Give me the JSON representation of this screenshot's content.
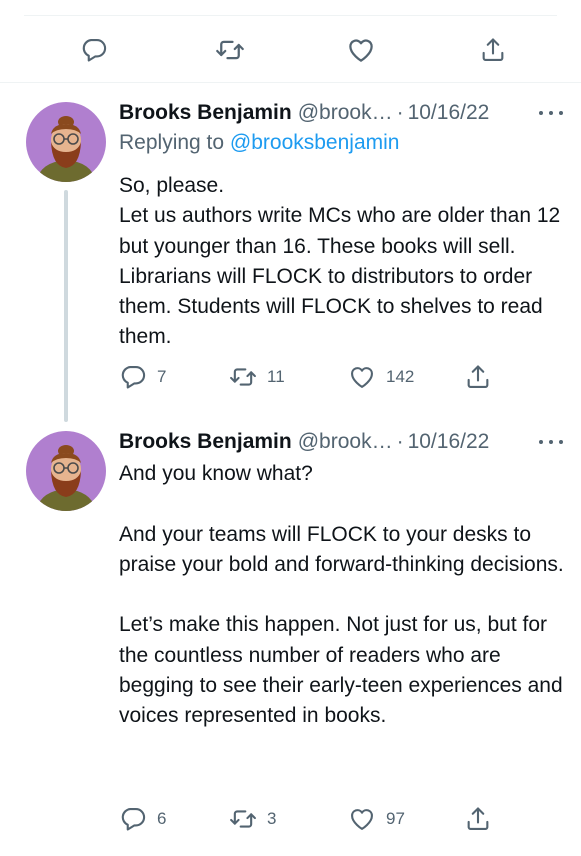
{
  "top_actions": {
    "reply_icon": "comment-icon",
    "retweet_icon": "retweet-icon",
    "like_icon": "heart-icon",
    "share_icon": "share-icon"
  },
  "tweets": [
    {
      "author": "Brooks Benjamin",
      "handle": "@brook…",
      "separator": "·",
      "date": "10/16/22",
      "replying_prefix": "Replying to ",
      "replying_to": "@brooksbenjamin",
      "text": "So, please.\nLet us authors write MCs who are older than 12 but younger than 16. These books will sell. Librarians will FLOCK to distributors to order them. Students will FLOCK to shelves to read them.",
      "replies": "7",
      "retweets": "11",
      "likes": "142"
    },
    {
      "author": "Brooks Benjamin",
      "handle": "@brook…",
      "separator": "·",
      "date": "10/16/22",
      "text": "And you know what?\n\nAnd your teams will FLOCK to your desks to praise your bold and forward-thinking decisions.\n\nLet’s make this happen. Not just for us, but for the countless number of readers who are begging to see their early-teen experiences and voices represented in books.",
      "replies": "6",
      "retweets": "3",
      "likes": "97"
    }
  ],
  "colors": {
    "text": "#0f1419",
    "secondary": "#536471",
    "link": "#1d9bf0",
    "avatar_bg": "#b07fcf",
    "divider": "#eff3f4",
    "thread": "#cfd9de"
  }
}
